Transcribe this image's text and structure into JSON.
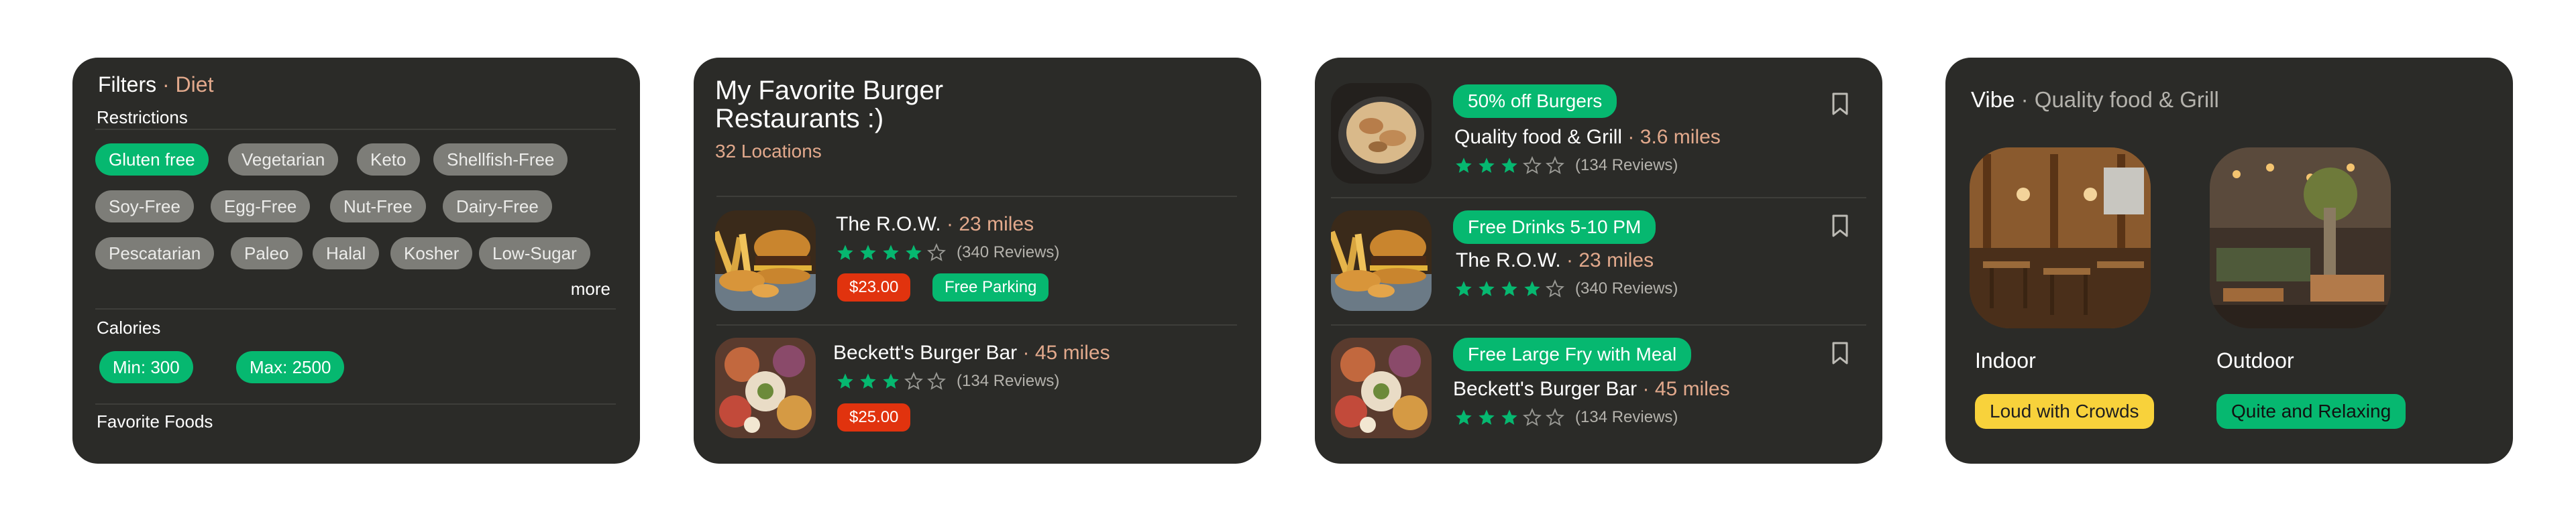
{
  "filters": {
    "title": "Filters",
    "separator": " · ",
    "subtitle": "Diet",
    "restrictions_label": "Restrictions",
    "diet_pills": [
      {
        "label": "Gluten free",
        "selected": true
      },
      {
        "label": "Vegetarian",
        "selected": false
      },
      {
        "label": "Keto",
        "selected": false
      },
      {
        "label": "Shellfish-Free",
        "selected": false
      },
      {
        "label": "Soy-Free",
        "selected": false
      },
      {
        "label": "Egg-Free",
        "selected": false
      },
      {
        "label": "Nut-Free",
        "selected": false
      },
      {
        "label": "Dairy-Free",
        "selected": false
      },
      {
        "label": "Pescatarian",
        "selected": false
      },
      {
        "label": "Paleo",
        "selected": false
      },
      {
        "label": "Halal",
        "selected": false
      },
      {
        "label": "Kosher",
        "selected": false
      },
      {
        "label": "Low-Sugar",
        "selected": false
      }
    ],
    "more_label": "more",
    "calories_label": "Calories",
    "calorie_min": "Min: 300",
    "calorie_max": "Max: 2500",
    "favorite_foods_label": "Favorite Foods"
  },
  "burger_list": {
    "title": "My Favorite Burger Restaurants :)",
    "count": "32 Locations",
    "items": [
      {
        "name": "The R.O.W.",
        "separator": " · ",
        "distance": "23 miles",
        "rating": 4,
        "reviews": "(340 Reviews)",
        "price": "$23.00",
        "tag": "Free Parking"
      },
      {
        "name": "Beckett's Burger Bar",
        "separator": " · ",
        "distance": "45 miles",
        "rating": 3,
        "reviews": "(134 Reviews)",
        "price": "$25.00"
      }
    ]
  },
  "deals": {
    "items": [
      {
        "deal": "50% off Burgers",
        "name": "Quality food & Grill",
        "separator": " · ",
        "distance": "3.6 miles",
        "rating": 3,
        "reviews": "(134 Reviews)"
      },
      {
        "deal": "Free Drinks 5-10 PM",
        "name": "The R.O.W.",
        "separator": " · ",
        "distance": "23 miles",
        "rating": 4,
        "reviews": "(340 Reviews)"
      },
      {
        "deal": "Free Large Fry with Meal",
        "name": "Beckett's Burger Bar",
        "separator": " · ",
        "distance": "45 miles",
        "rating": 3,
        "reviews": "(134 Reviews)"
      }
    ]
  },
  "vibe": {
    "title": "Vibe",
    "separator": " · ",
    "restaurant": "Quality food & Grill",
    "options": [
      {
        "label": "Indoor",
        "chip": "Loud with Crowds"
      },
      {
        "label": "Outdoor",
        "chip": "Quite and Relaxing"
      }
    ]
  },
  "colors": {
    "card_bg": "#2b2b28",
    "accent_green": "#06b870",
    "accent_peach": "#e2a98c",
    "price_red": "#e1330e",
    "chip_yellow": "#f8d23b"
  },
  "icons": {
    "star": "star-icon",
    "bookmark": "bookmark-icon"
  }
}
